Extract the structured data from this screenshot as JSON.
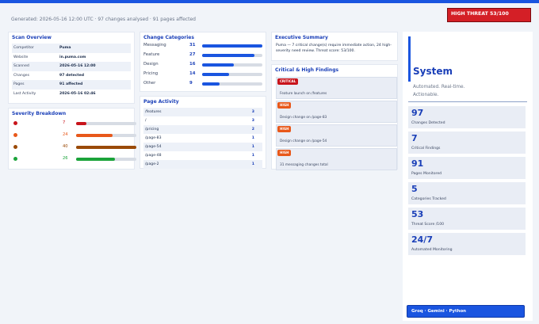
{
  "header": {
    "meta": "Generated: 2026-05-16 12:00 UTC  ·  97 changes analysed  ·  91 pages affected",
    "threat_badge": "HIGH THREAT  53/100",
    "threat_color": "#d41f26"
  },
  "scan_overview": {
    "title": "Scan Overview",
    "rows": [
      {
        "key": "Competitor",
        "value": "Puma"
      },
      {
        "key": "Website",
        "value": "in.puma.com"
      },
      {
        "key": "Scanned",
        "value": "2026-05-16 12:00"
      },
      {
        "key": "Changes",
        "value": "97 detected"
      },
      {
        "key": "Pages",
        "value": "91 affected"
      },
      {
        "key": "Last Activity",
        "value": "2026-05-16 02:46"
      }
    ]
  },
  "severity": {
    "title": "Severity Breakdown",
    "items": [
      {
        "value": "7",
        "fraction": 0.17,
        "color": "#c8141b"
      },
      {
        "value": "24",
        "fraction": 0.6,
        "color": "#e8581a"
      },
      {
        "value": "40",
        "fraction": 1.0,
        "color": "#9a4a07"
      },
      {
        "value": "26",
        "fraction": 0.65,
        "color": "#1ba33a"
      }
    ]
  },
  "change_categories": {
    "title": "Change Categories",
    "items": [
      {
        "label": "Messaging",
        "value": "31",
        "fraction": 1.0
      },
      {
        "label": "Feature",
        "value": "27",
        "fraction": 0.87
      },
      {
        "label": "Design",
        "value": "16",
        "fraction": 0.52
      },
      {
        "label": "Pricing",
        "value": "14",
        "fraction": 0.45
      },
      {
        "label": "Other",
        "value": "9",
        "fraction": 0.29
      }
    ]
  },
  "page_activity": {
    "title": "Page Activity",
    "rows": [
      {
        "path": "/features",
        "count": "3"
      },
      {
        "path": "/",
        "count": "3"
      },
      {
        "path": "/pricing",
        "count": "2"
      },
      {
        "path": "/page-83",
        "count": "1"
      },
      {
        "path": "/page-54",
        "count": "1"
      },
      {
        "path": "/page-48",
        "count": "1"
      },
      {
        "path": "/page-2",
        "count": "1"
      }
    ]
  },
  "executive_summary": {
    "title": "Executive Summary",
    "text": "Puma — 7 critical change(s) require immediate action, 24 high-severity need review. Threat score: 53/100."
  },
  "findings": {
    "title": "Critical & High Findings",
    "items": [
      {
        "badge": "CRITICAL",
        "color": "#c8141b",
        "text": "Feature launch on /features"
      },
      {
        "badge": "HIGH",
        "color": "#e8581a",
        "text": "Design change on /page-83"
      },
      {
        "badge": "HIGH",
        "color": "#e8581a",
        "text": "Design change on /page-54"
      },
      {
        "badge": "HIGH",
        "color": "#e8581a",
        "text": "31 messaging changes total"
      }
    ]
  },
  "system": {
    "title": "System",
    "subtitle": "Automated. Real-time. Actionable.",
    "stats": [
      {
        "value": "97",
        "label": "Changes Detected"
      },
      {
        "value": "7",
        "label": "Critical Findings"
      },
      {
        "value": "91",
        "label": "Pages Monitored"
      },
      {
        "value": "5",
        "label": "Categories Tracked"
      },
      {
        "value": "53",
        "label": "Threat Score /100"
      },
      {
        "value": "24/7",
        "label": "Automated Monitoring"
      }
    ],
    "tech": "Groq · Gemini · Python"
  }
}
